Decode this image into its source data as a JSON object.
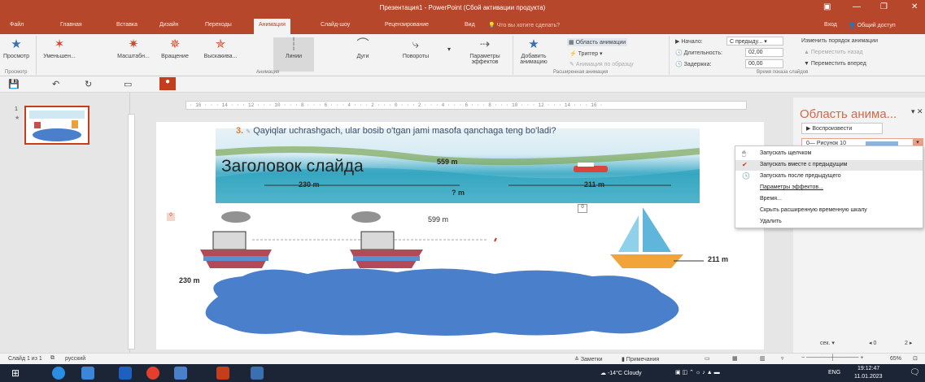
{
  "window": {
    "title": "Презентация1 - PowerPoint (Сбой активации продукта)",
    "controls": [
      "▣",
      "—",
      "❐",
      "✕"
    ]
  },
  "tabs": [
    "Файл",
    "Главная",
    "Вставка",
    "Дизайн",
    "Переходы",
    "Анимация",
    "Слайд-шоу",
    "Рецензирование",
    "Вид"
  ],
  "active_tab": "Анимация",
  "tell_me": "Что вы хотите сделать?",
  "account": {
    "signin": "Вход",
    "share": "Общий доступ"
  },
  "ribbon": {
    "preview": {
      "label": "Просмотр",
      "group": "Просмотр"
    },
    "animations": {
      "items": [
        "Уменьшен...",
        "Масштабн...",
        "Вращение",
        "Выскакива...",
        "Линии",
        "Дуги",
        "Повороты"
      ],
      "group": "Анимация",
      "effect_options": [
        "Параметры",
        "эффектов"
      ]
    },
    "advanced": {
      "add_animation": [
        "Добавить",
        "анимацию"
      ],
      "animation_pane": "Область анимации",
      "trigger": "Триггер",
      "painter": "Анимация по образцу",
      "group": "Расширенная анимация"
    },
    "timing": {
      "start_label": "Начало:",
      "start_value": "С предыду...",
      "duration_label": "Длительность:",
      "duration_value": "02,00",
      "delay_label": "Задержка:",
      "delay_value": "00,00",
      "reorder_label": "Изменить порядок анимации",
      "move_earlier": "Переместить назад",
      "move_later": "Переместить вперед",
      "group": "Время показа слайдов"
    }
  },
  "thumbnail": {
    "number": "1"
  },
  "ruler_text": "· 16 · · · 14 · · · 12 · · · 10 · · · 8 · · · 6 · · · 4 · · · 2 · · · 0 · · · 2 · · · 4 · · · 6 · · · 8 · · · 10 · · · 12 · · · 14 · · · 16 ·",
  "slide": {
    "problem_number": "3.",
    "problem_text": "Qayiqlar uchrashgach, ular bosib o'tgan jami masofa qanchaga teng bo'ladi?",
    "title_placeholder": "Заголовок слайда",
    "dist_top": "559 m",
    "dist_left": "230 m",
    "dist_unknown": "? m",
    "dist_right": "211 m",
    "label_599": "599 m",
    "label_230": "230 m",
    "label_211": "211 m",
    "tag_zero_left": "0",
    "tag_zero_mid": "0"
  },
  "animation_pane": {
    "title": "Область анима...",
    "play": "Воспроизвести",
    "item": "0— Рисунок 10"
  },
  "context_menu": [
    "Запускать щелчком",
    "Запускать вместе с предыдущим",
    "Запускать после предыдущего",
    "Параметры эффектов...",
    "Время...",
    "Скрыть расширенную временную шкалу",
    "Удалить"
  ],
  "pane_footer": {
    "sec": "сек.",
    "zoom_from": "0",
    "zoom_to": "2"
  },
  "status": {
    "slide_info": "Слайд 1 из 1",
    "language": "русский",
    "notes": "Заметки",
    "comments": "Примечания",
    "zoom": "65%"
  },
  "taskbar": {
    "weather": "-14°C Cloudy",
    "lang": "ENG",
    "time": "19:12:47",
    "date": "11.01.2023"
  },
  "colors": {
    "accent": "#b7472a",
    "ribbon_bg": "#f3f3f3",
    "pane_title": "#d06a4c",
    "cloud": "#4a7fcb",
    "taskbar": "#1b2535"
  }
}
